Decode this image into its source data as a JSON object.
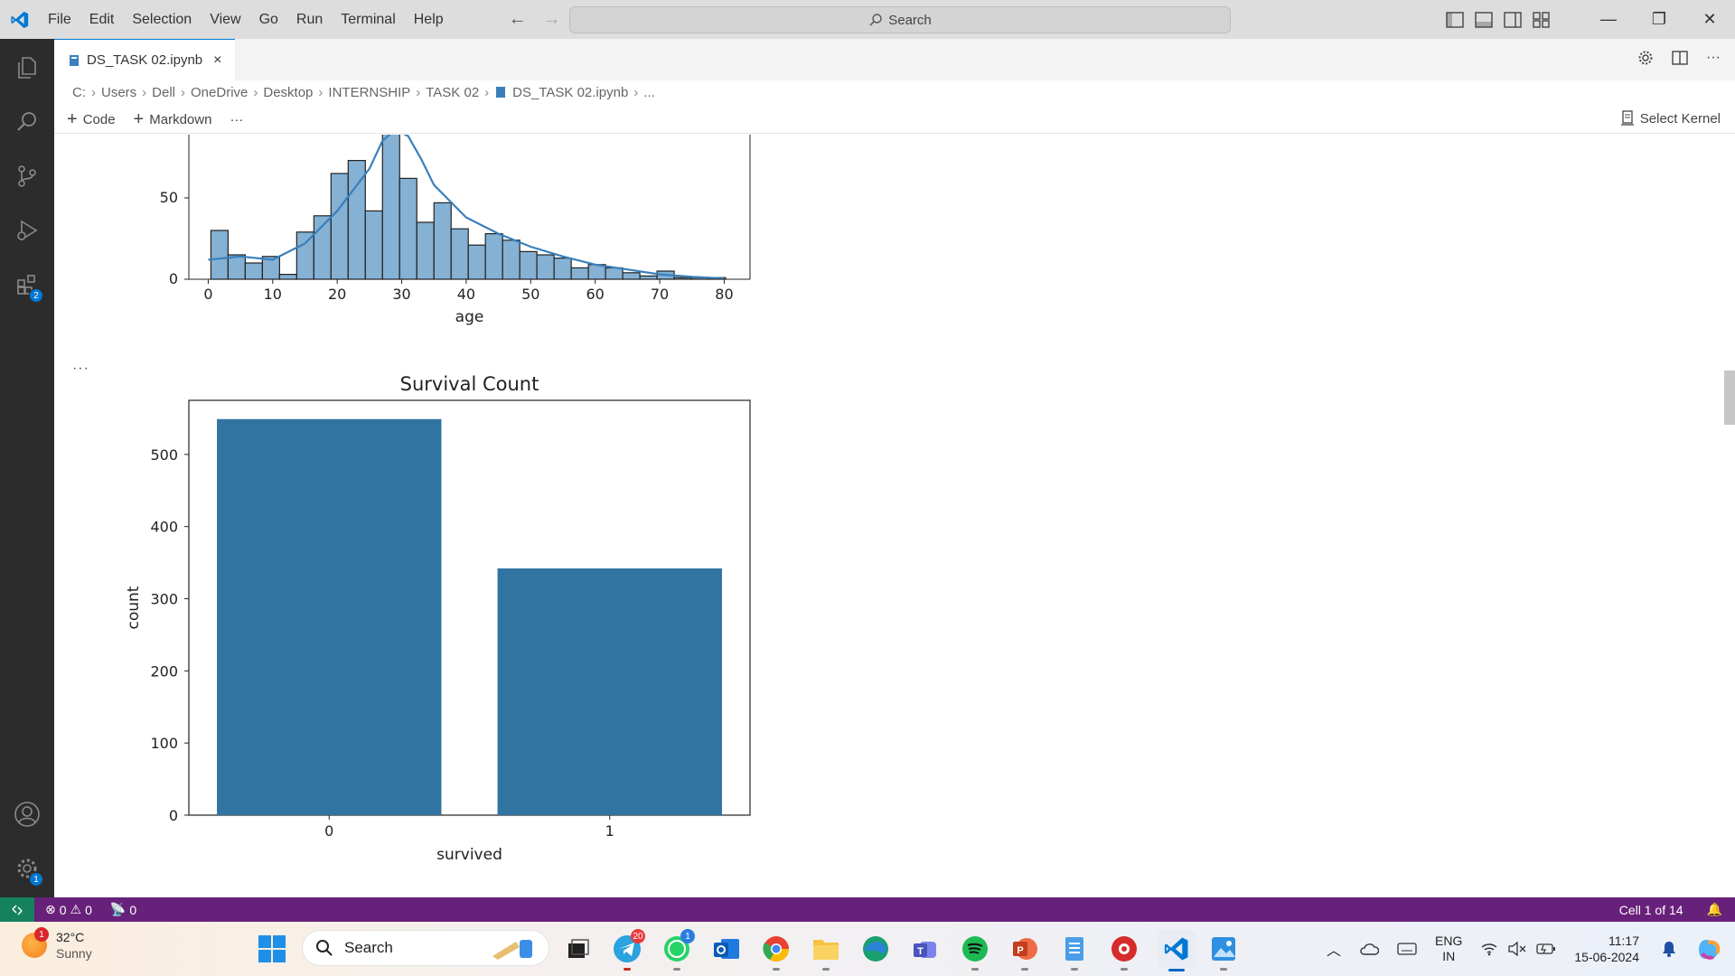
{
  "menu": [
    "File",
    "Edit",
    "Selection",
    "View",
    "Go",
    "Run",
    "Terminal",
    "Help"
  ],
  "search": {
    "label": "Search"
  },
  "tab": {
    "label": "DS_TASK 02.ipynb",
    "close": "×"
  },
  "breadcrumb": [
    "C:",
    "Users",
    "Dell",
    "OneDrive",
    "Desktop",
    "INTERNSHIP",
    "TASK 02",
    "DS_TASK 02.ipynb",
    "..."
  ],
  "toolbar": {
    "code_label": "Code",
    "markdown_label": "Markdown",
    "more": "···",
    "kernel_label": "Select Kernel"
  },
  "output_dots": "···",
  "activity_badges": {
    "extensions": "2",
    "settings": "1"
  },
  "colors": {
    "accent": "#0078d4",
    "statusbar": "#68217a",
    "remote": "#16825d",
    "bar": "#3274a1",
    "hist": "#84b1d4",
    "kde": "#3a7fba"
  },
  "chart_data": [
    {
      "type": "bar",
      "chart_kind": "histogram with kde",
      "title": "",
      "xlabel": "age",
      "ylabel": "",
      "xlim": [
        -3,
        84
      ],
      "ylim": [
        0,
        90
      ],
      "xticks": [
        0,
        10,
        20,
        30,
        40,
        50,
        60,
        70,
        80
      ],
      "yticks": [
        0,
        50
      ],
      "bin_edges": [
        0.42,
        3.08,
        5.74,
        8.4,
        11.06,
        13.72,
        16.38,
        19.04,
        21.7,
        24.36,
        27.02,
        29.68,
        32.34,
        35.0,
        37.66,
        40.32,
        42.98,
        45.64,
        48.3,
        50.96,
        53.62,
        56.28,
        58.94,
        61.6,
        64.26,
        66.92,
        69.58,
        72.24,
        74.9,
        77.56,
        80.22
      ],
      "values": [
        30,
        15,
        10,
        14,
        3,
        29,
        39,
        65,
        73,
        42,
        90,
        62,
        35,
        47,
        31,
        21,
        28,
        24,
        17,
        15,
        13,
        7,
        9,
        7,
        4,
        2,
        5,
        1,
        1,
        1
      ],
      "kde": [
        [
          0,
          12
        ],
        [
          5,
          14
        ],
        [
          10,
          12
        ],
        [
          15,
          22
        ],
        [
          20,
          42
        ],
        [
          25,
          68
        ],
        [
          27,
          85
        ],
        [
          29,
          92
        ],
        [
          31,
          88
        ],
        [
          33,
          74
        ],
        [
          35,
          58
        ],
        [
          40,
          38
        ],
        [
          45,
          28
        ],
        [
          50,
          20
        ],
        [
          55,
          14
        ],
        [
          60,
          9
        ],
        [
          65,
          6
        ],
        [
          70,
          3
        ],
        [
          75,
          1.5
        ],
        [
          80,
          0.5
        ]
      ]
    },
    {
      "type": "bar",
      "title": "Survival Count",
      "xlabel": "survived",
      "ylabel": "count",
      "categories": [
        "0",
        "1"
      ],
      "values": [
        549,
        342
      ],
      "ylim": [
        0,
        575
      ],
      "yticks": [
        0,
        100,
        200,
        300,
        400,
        500
      ]
    }
  ],
  "status": {
    "errors": "0",
    "warnings": "0",
    "ports": "0",
    "cell": "Cell 1 of 14"
  },
  "taskbar": {
    "temp": "32°C",
    "weather": "Sunny",
    "weather_badge": "1",
    "search_label": "Search",
    "telegram_badge": "20",
    "whatsapp_badge": "1",
    "lang_top": "ENG",
    "lang_bottom": "IN",
    "time": "11:17",
    "date": "15-06-2024"
  }
}
